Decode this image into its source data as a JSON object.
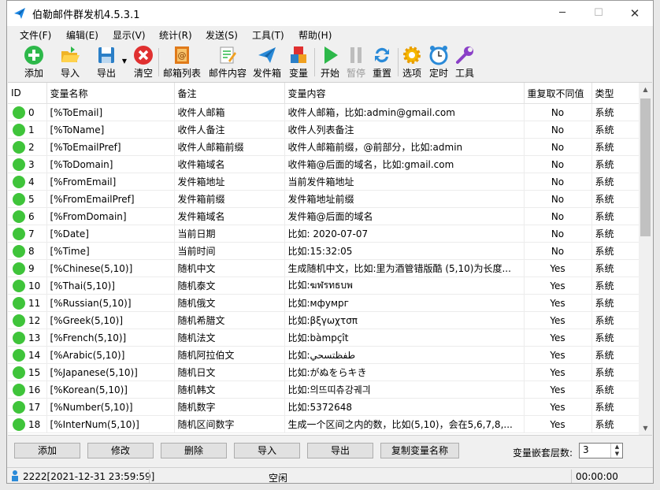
{
  "window": {
    "title": "伯勒邮件群发机4.5.3.1",
    "minimize": "─",
    "maximize": "☐",
    "close": "✕"
  },
  "menus": [
    "文件(F)",
    "编辑(E)",
    "显示(V)",
    "统计(R)",
    "发送(S)",
    "工具(T)",
    "帮助(H)"
  ],
  "toolbar": {
    "add": "添加",
    "import": "导入",
    "export": "导出",
    "clear": "清空",
    "mail_list": "邮箱列表",
    "mail_content": "邮件内容",
    "outbox": "发件箱",
    "variables": "变量",
    "start": "开始",
    "pause": "暂停",
    "reset": "重置",
    "options": "选项",
    "timer": "定时",
    "tools": "工具"
  },
  "table": {
    "columns": [
      "ID",
      "变量名称",
      "备注",
      "变量内容",
      "重复取不同值",
      "类型"
    ],
    "rows": [
      {
        "id": "0",
        "name": "[%ToEmail]",
        "note": "收件人邮箱",
        "content": "收件人邮箱，比如:admin@gmail.com",
        "repeat": "No",
        "type": "系统"
      },
      {
        "id": "1",
        "name": "[%ToName]",
        "note": "收件人备注",
        "content": "收件人列表备注",
        "repeat": "No",
        "type": "系统"
      },
      {
        "id": "2",
        "name": "[%ToEmailPref]",
        "note": "收件人邮箱前缀",
        "content": "收件人邮箱前缀，@前部分，比如:admin",
        "repeat": "No",
        "type": "系统"
      },
      {
        "id": "3",
        "name": "[%ToDomain]",
        "note": "收件箱域名",
        "content": "收件箱@后面的域名，比如:gmail.com",
        "repeat": "No",
        "type": "系统"
      },
      {
        "id": "4",
        "name": "[%FromEmail]",
        "note": "发件箱地址",
        "content": "当前发件箱地址",
        "repeat": "No",
        "type": "系统"
      },
      {
        "id": "5",
        "name": "[%FromEmailPref]",
        "note": "发件箱前缀",
        "content": "发件箱地址前缀",
        "repeat": "No",
        "type": "系统"
      },
      {
        "id": "6",
        "name": "[%FromDomain]",
        "note": "发件箱域名",
        "content": "发件箱@后面的域名",
        "repeat": "No",
        "type": "系统"
      },
      {
        "id": "7",
        "name": "[%Date]",
        "note": "当前日期",
        "content": "比如: 2020-07-07",
        "repeat": "No",
        "type": "系统"
      },
      {
        "id": "8",
        "name": "[%Time]",
        "note": "当前时间",
        "content": "比如:15:32:05",
        "repeat": "No",
        "type": "系统"
      },
      {
        "id": "9",
        "name": "[%Chinese(5,10)]",
        "note": "随机中文",
        "content": "生成随机中文，比如:里为酒管错版酷 (5,10)为长度...",
        "repeat": "Yes",
        "type": "系统"
      },
      {
        "id": "10",
        "name": "[%Thai(5,10)]",
        "note": "随机泰文",
        "content": "比如:ฆฬรทธบพ",
        "repeat": "Yes",
        "type": "系统"
      },
      {
        "id": "11",
        "name": "[%Russian(5,10)]",
        "note": "随机俄文",
        "content": "比如:мфумрг",
        "repeat": "Yes",
        "type": "系统"
      },
      {
        "id": "12",
        "name": "[%Greek(5,10)]",
        "note": "随机希腊文",
        "content": "比如:βξγωχτσπ",
        "repeat": "Yes",
        "type": "系统"
      },
      {
        "id": "13",
        "name": "[%French(5,10)]",
        "note": "随机法文",
        "content": "比如:bàmpçît",
        "repeat": "Yes",
        "type": "系统"
      },
      {
        "id": "14",
        "name": "[%Arabic(5,10)]",
        "note": "随机阿拉伯文",
        "content": "比如:طفظتسحي",
        "repeat": "Yes",
        "type": "系统"
      },
      {
        "id": "15",
        "name": "[%Japanese(5,10)]",
        "note": "随机日文",
        "content": "比如:がぬをらキき",
        "repeat": "Yes",
        "type": "系统"
      },
      {
        "id": "16",
        "name": "[%Korean(5,10)]",
        "note": "随机韩文",
        "content": "比如:의뜨띠츄강궤긔",
        "repeat": "Yes",
        "type": "系统"
      },
      {
        "id": "17",
        "name": "[%Number(5,10)]",
        "note": "随机数字",
        "content": "比如:5372648",
        "repeat": "Yes",
        "type": "系统"
      },
      {
        "id": "18",
        "name": "[%InterNum(5,10)]",
        "note": "随机区间数字",
        "content": "生成一个区间之内的数，比如(5,10)，会在5,6,7,8,...",
        "repeat": "Yes",
        "type": "系统"
      }
    ]
  },
  "buttons": {
    "add": "添加",
    "edit": "修改",
    "delete": "删除",
    "import": "导入",
    "export": "导出",
    "copy_name": "复制变量名称"
  },
  "nesting": {
    "label": "变量嵌套层数:",
    "value": "3"
  },
  "status": {
    "info": "2222[2021-12-31 23:59:59]",
    "state": "空闲",
    "time": "00:00:00"
  },
  "colors": {
    "status_dot": "#3fc43a",
    "accent": "#1e88e5"
  }
}
